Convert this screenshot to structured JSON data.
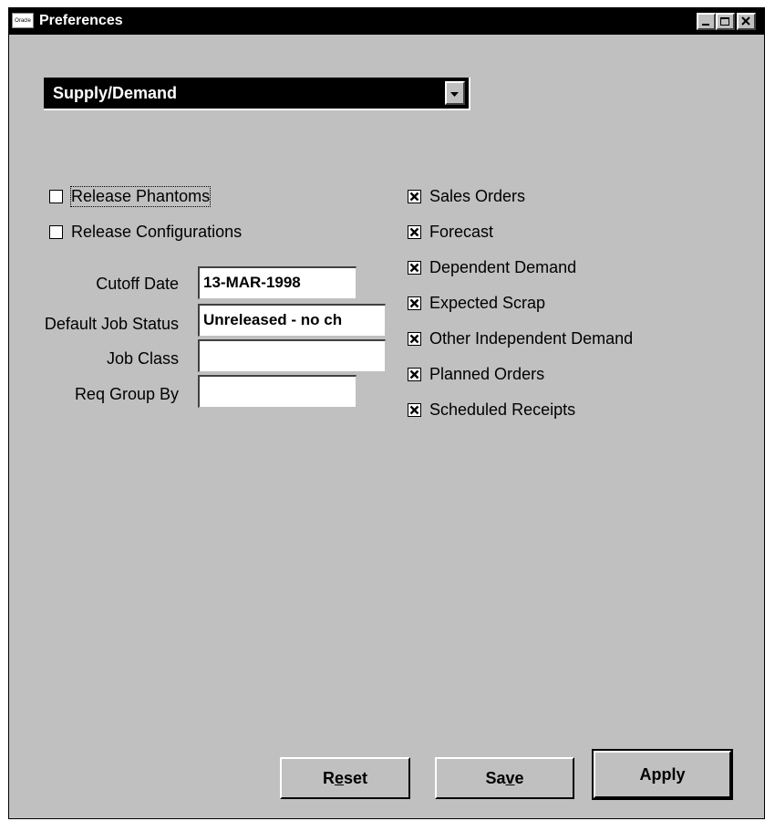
{
  "window": {
    "icon_text": "Oracle",
    "title": "Preferences"
  },
  "dropdown": {
    "selected": "Supply/Demand"
  },
  "left_checkboxes": [
    {
      "label": "Release Phantoms",
      "checked": false
    },
    {
      "label": "Release Configurations",
      "checked": false
    }
  ],
  "fields": [
    {
      "label": "Cutoff Date",
      "value": "13-MAR-1998"
    },
    {
      "label": "Default Job Status",
      "value": "Unreleased - no ch"
    },
    {
      "label": "Job Class",
      "value": ""
    },
    {
      "label": "Req Group By",
      "value": ""
    }
  ],
  "right_checkboxes": [
    {
      "label": "Sales Orders",
      "checked": true
    },
    {
      "label": "Forecast",
      "checked": true
    },
    {
      "label": "Dependent Demand",
      "checked": true
    },
    {
      "label": "Expected Scrap",
      "checked": true
    },
    {
      "label": "Other Independent Demand",
      "checked": true
    },
    {
      "label": "Planned Orders",
      "checked": true
    },
    {
      "label": "Scheduled Receipts",
      "checked": true
    }
  ],
  "buttons": {
    "reset": {
      "before": "R",
      "mnemonic": "e",
      "after": "set"
    },
    "save": {
      "before": "Sa",
      "mnemonic": "v",
      "after": "e"
    },
    "apply": "Apply"
  }
}
